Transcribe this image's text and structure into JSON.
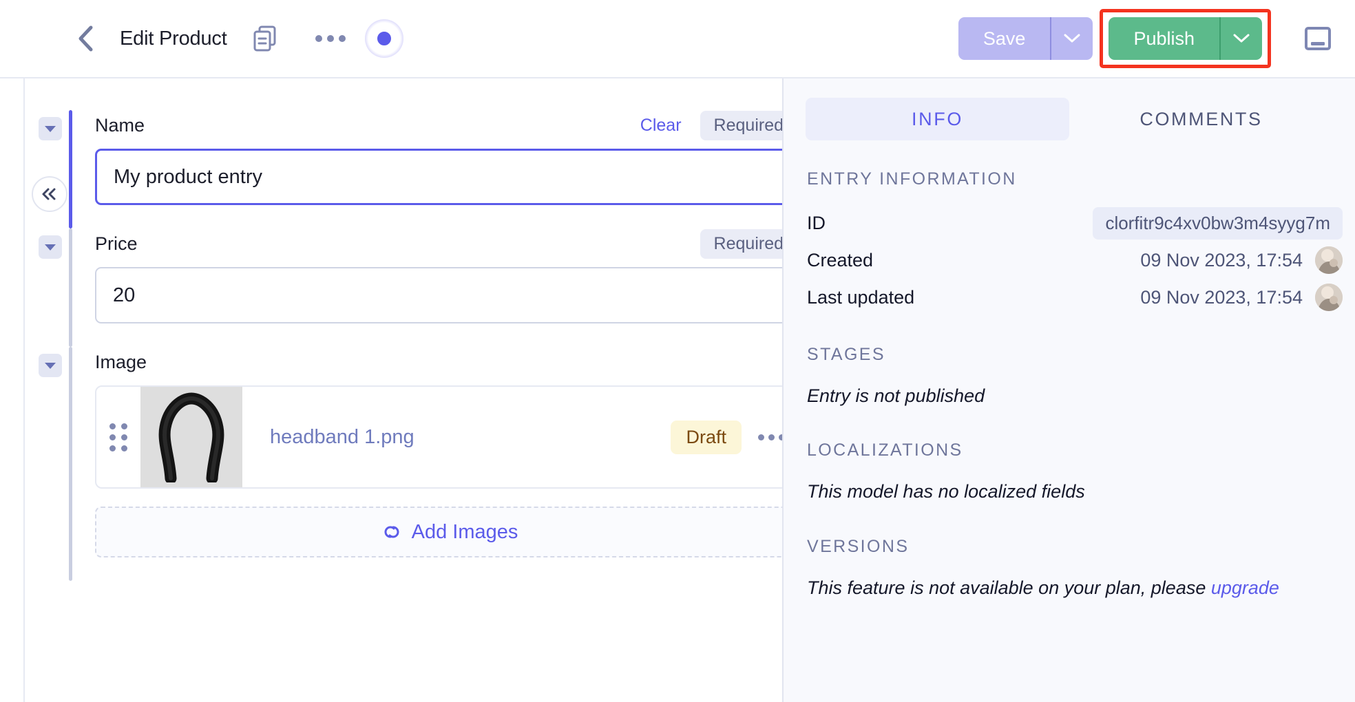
{
  "header": {
    "back_icon": "chevron-left-icon",
    "title": "Edit Product",
    "duplicate_icon": "duplicate-icon",
    "overflow_icon": "ellipsis-icon",
    "status_indicator": "unsaved-changes-dot",
    "save_label": "Save",
    "save_caret_icon": "chevron-down-icon",
    "publish_label": "Publish",
    "publish_caret_icon": "chevron-down-icon",
    "panel_toggle_icon": "panel-toggle-icon",
    "highlight_color": "#f4331f",
    "save_color": "#b9b8f2",
    "publish_color": "#5cba8b"
  },
  "rails": {
    "collapse_left_icon": "chevrons-left-icon",
    "collapse_right_icon": "chevrons-right-icon"
  },
  "form": {
    "fields": [
      {
        "label": "Name",
        "clear_label": "Clear",
        "required_label": "Required",
        "value": "My product entry",
        "focused": true,
        "toggle_icon": "caret-down-icon"
      },
      {
        "label": "Price",
        "required_label": "Required",
        "value": "20",
        "focused": false,
        "toggle_icon": "caret-down-icon"
      },
      {
        "label": "Image",
        "toggle_icon": "caret-down-icon"
      }
    ],
    "asset": {
      "drag_handle_icon": "drag-handle-icon",
      "thumbnail_alt": "black headband product photo",
      "filename": "headband 1.png",
      "status_badge": "Draft",
      "overflow_icon": "ellipsis-icon"
    },
    "add_images": {
      "label": "Add Images",
      "icon": "link-chain-icon"
    }
  },
  "sidebar": {
    "tabs": [
      {
        "label": "INFO",
        "active": true
      },
      {
        "label": "COMMENTS",
        "active": false
      }
    ],
    "entry_information": {
      "title": "ENTRY INFORMATION",
      "rows": [
        {
          "key": "ID",
          "value": "clorfitr9c4xv0bw3m4syyg7m",
          "pill": true,
          "avatar": false
        },
        {
          "key": "Created",
          "value": "09 Nov 2023, 17:54",
          "pill": false,
          "avatar": true
        },
        {
          "key": "Last updated",
          "value": "09 Nov 2023, 17:54",
          "pill": false,
          "avatar": true
        }
      ]
    },
    "stages": {
      "title": "STAGES",
      "text": "Entry is not published"
    },
    "localizations": {
      "title": "LOCALIZATIONS",
      "text": "This model has no localized fields"
    },
    "versions": {
      "title": "VERSIONS",
      "text_before": "This feature is not available on your plan, please ",
      "link_label": "upgrade"
    }
  }
}
